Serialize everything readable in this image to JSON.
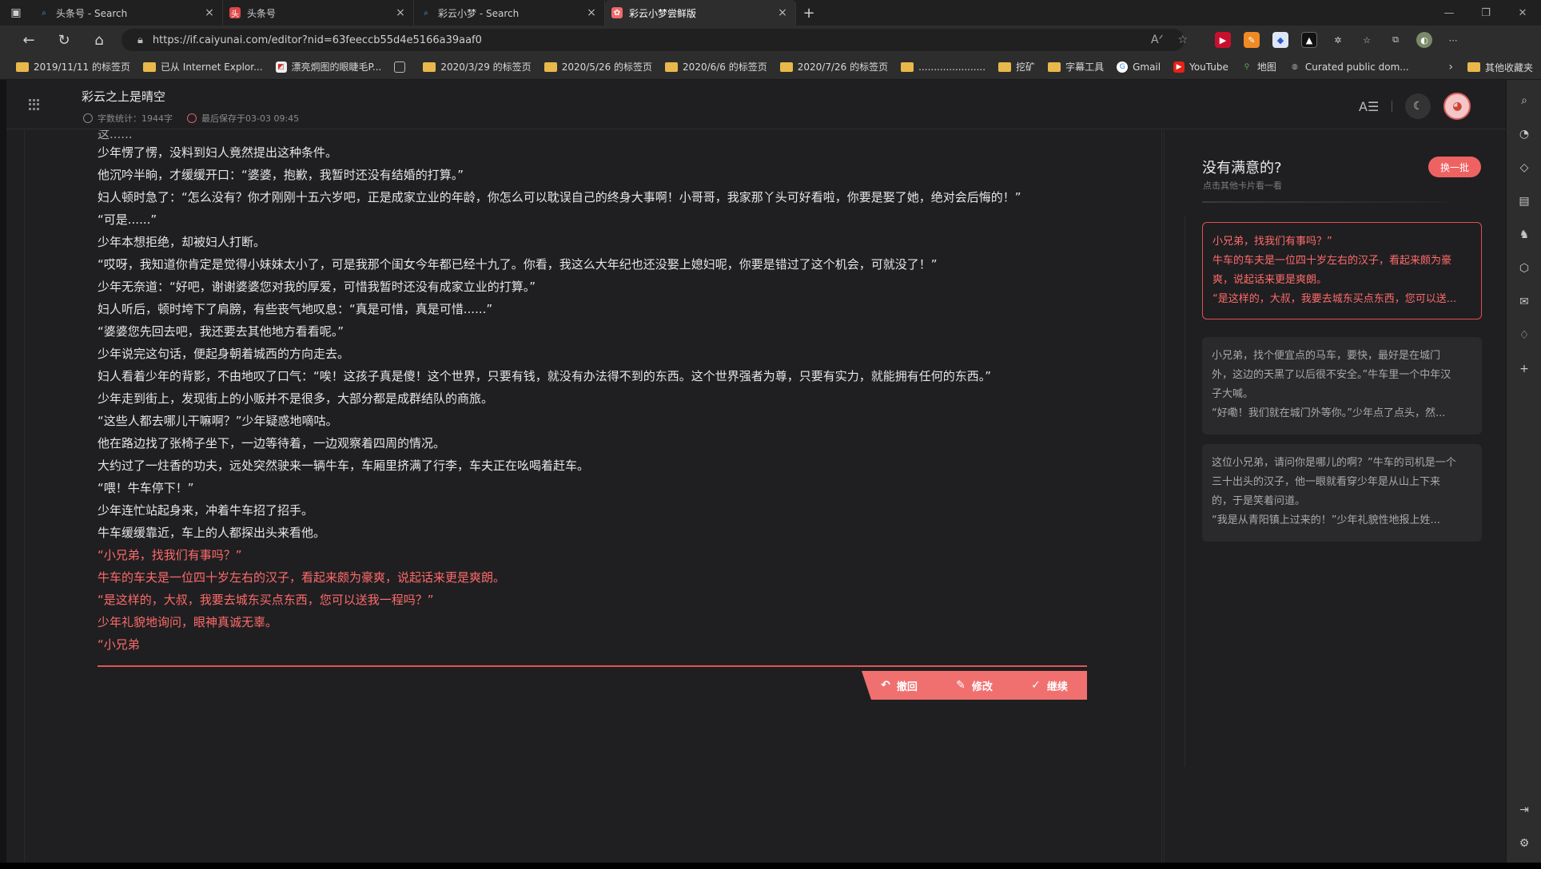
{
  "browser": {
    "tabs": [
      {
        "title": "头条号 - Search",
        "favicon": "search-icon"
      },
      {
        "title": "头条号",
        "favicon": "toutiao-icon"
      },
      {
        "title": "彩云小梦 - Search",
        "favicon": "search-icon"
      },
      {
        "title": "彩云小梦尝鲜版",
        "favicon": "caiyun-icon"
      }
    ],
    "url": "https://if.caiyunai.com/editor?nid=63feeccb55d4e5166a39aaf0",
    "bookmarks": [
      "2019/11/11 的标签页",
      "已从 Internet Explor...",
      "漂亮炯图的眼睫毛P...",
      "",
      "2020/3/29 的标签页",
      "2020/5/26 的标签页",
      "2020/6/6 的标签页",
      "2020/7/26 的标签页",
      "......................",
      "挖矿",
      "字幕工具",
      "Gmail",
      "YouTube",
      "地图",
      "Curated public dom..."
    ],
    "other_bookmarks": "其他收藏夹"
  },
  "doc": {
    "title": "彩云之上是晴空",
    "word_count": "字数统计：1944字",
    "last_saved": "最后保存于03-03 09:45"
  },
  "editor": {
    "cut_line": "这......",
    "lines": [
      "少年愣了愣，没料到妇人竟然提出这种条件。",
      "他沉吟半晌，才缓缓开口：“婆婆，抱歉，我暂时还没有结婚的打算。”",
      "妇人顿时急了：“怎么没有？你才刚刚十五六岁吧，正是成家立业的年龄，你怎么可以耽误自己的终身大事啊！小哥哥，我家那丫头可好看啦，你要是娶了她，绝对会后悔的！”",
      "“可是......”",
      "少年本想拒绝，却被妇人打断。",
      "“哎呀，我知道你肯定是觉得小妹妹太小了，可是我那个闺女今年都已经十九了。你看，我这么大年纪也还没娶上媳妇呢，你要是错过了这个机会，可就没了！”",
      "少年无奈道：“好吧，谢谢婆婆您对我的厚爱，可惜我暂时还没有成家立业的打算。”",
      "妇人听后，顿时垮下了肩膀，有些丧气地叹息：“真是可惜，真是可惜......”",
      "“婆婆您先回去吧，我还要去其他地方看看呢。”",
      "少年说完这句话，便起身朝着城西的方向走去。",
      "妇人看着少年的背影，不由地叹了口气：“唉！这孩子真是傻！这个世界，只要有钱，就没有办法得不到的东西。这个世界强者为尊，只要有实力，就能拥有任何的东西。”",
      "少年走到街上，发现街上的小贩并不是很多，大部分都是成群结队的商旅。",
      "“这些人都去哪儿干嘛啊？”少年疑惑地嘀咕。",
      "他在路边找了张椅子坐下，一边等待着，一边观察着四周的情况。",
      "大约过了一炷香的功夫，远处突然驶来一辆牛车，车厢里挤满了行李，车夫正在吆喝着赶车。",
      "“喂！牛车停下！”",
      "少年连忙站起身来，冲着牛车招了招手。",
      "牛车缓缓靠近，车上的人都探出头来看他。"
    ],
    "ai_lines": [
      "“小兄弟，找我们有事吗？”",
      "牛车的车夫是一位四十岁左右的汉子，看起来颇为豪爽，说起话来更是爽朗。",
      "“是这样的，大叔，我要去城东买点东西，您可以送我一程吗？”",
      "少年礼貌地询问，眼神真诚无辜。",
      "“小兄弟"
    ],
    "actions": {
      "undo": "撤回",
      "edit": "修改",
      "continue": "继续"
    }
  },
  "panel": {
    "title": "没有满意的?",
    "subtitle": "点击其他卡片看一看",
    "refresh_button": "换一批",
    "cards": [
      {
        "lines": [
          "小兄弟，找我们有事吗？”",
          "牛车的车夫是一位四十岁左右的汉子，看起来颇为豪",
          "爽，说起话来更是爽朗。",
          "“是这样的，大叔，我要去城东买点东西，您可以送..."
        ],
        "selected": true
      },
      {
        "lines": [
          "小兄弟，找个便宜点的马车，要快，最好是在城门",
          "外，这边的天黑了以后很不安全。”牛车里一个中年汉",
          "子大喊。",
          "“好嘞！我们就在城门外等你。”少年点了点头，然..."
        ],
        "selected": false
      },
      {
        "lines": [
          "这位小兄弟，请问你是哪儿的啊？”牛车的司机是一个",
          "三十出头的汉子，他一眼就看穿少年是从山上下来",
          "的，于是笑着问道。",
          "“我是从青阳镇上过来的！”少年礼貌性地报上姓..."
        ],
        "selected": false
      }
    ]
  },
  "colors": {
    "accent": "#ef6262",
    "ai_text": "#ff6a6a",
    "background": "#1f1f21"
  }
}
